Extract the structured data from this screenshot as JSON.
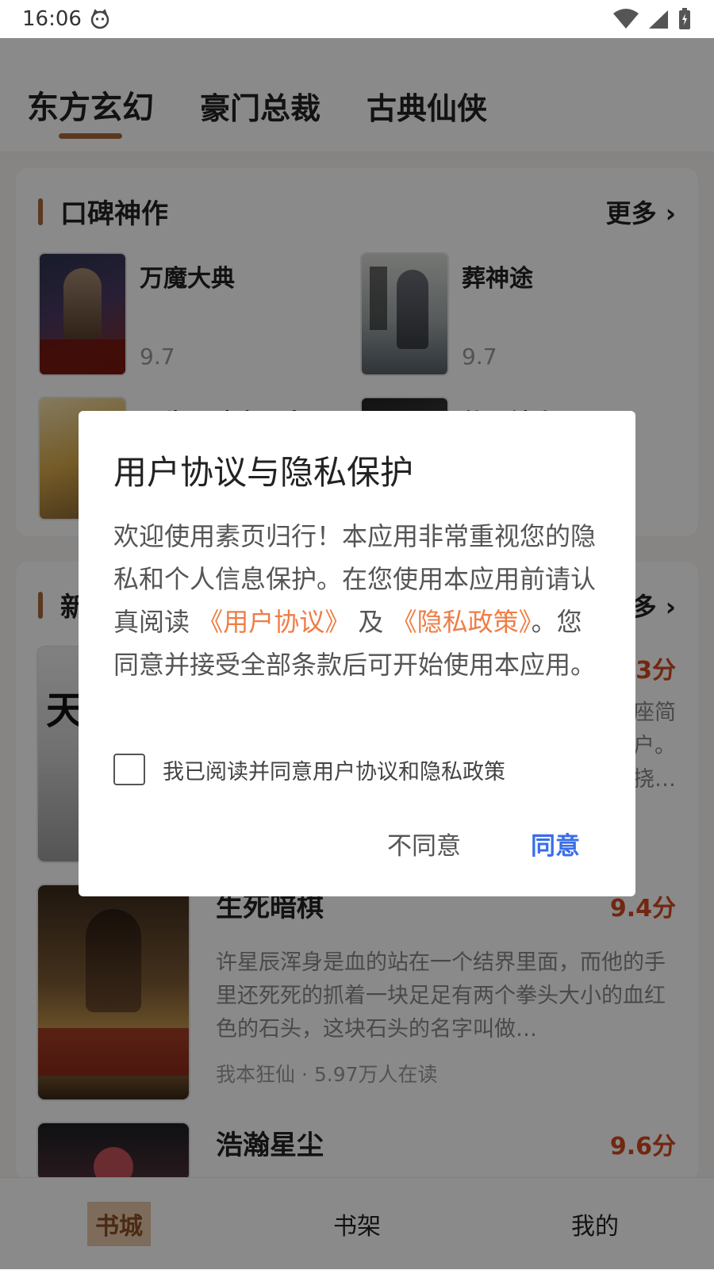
{
  "status_bar": {
    "time": "16:06"
  },
  "tabs": [
    {
      "label": "东方玄幻"
    },
    {
      "label": "豪门总裁"
    },
    {
      "label": "古典仙侠"
    }
  ],
  "section1": {
    "title": "口碑神作",
    "more": "更多 ›",
    "books": [
      {
        "name": "万魔大典",
        "score": "9.7"
      },
      {
        "name": "葬神途",
        "score": "9.7"
      },
      {
        "name": "三生石破魔厄出",
        "score": ""
      },
      {
        "name": "仙王神尘",
        "score": ""
      }
    ]
  },
  "section2": {
    "title": "新",
    "more": "多 ›",
    "books": [
      {
        "name": "天",
        "score": "3分",
        "desc": "座简\n户。\n挠…",
        "meta": ""
      },
      {
        "name": "生死暗棋",
        "score": "9.4分",
        "desc": "许星辰浑身是血的站在一个结界里面，而他的手里还死死的抓着一块足足有两个拳头大小的血红色的石头，这块石头的名字叫做…",
        "meta": "我本狂仙 · 5.97万人在读"
      },
      {
        "name": "浩瀚星尘",
        "score": "9.6分",
        "desc": "",
        "meta": ""
      }
    ]
  },
  "bottom_nav": [
    {
      "label": "书城"
    },
    {
      "label": "书架"
    },
    {
      "label": "我的"
    }
  ],
  "dialog": {
    "title": "用户协议与隐私保护",
    "body_part1": "欢迎使用素页归行！本应用非常重视您的隐私和个人信息保护。在您使用本应用前请认真阅读 ",
    "link_terms": "《用户协议》",
    "body_and": " 及 ",
    "link_privacy": "《隐私政策》",
    "body_part2": "。您同意并接受全部条款后可开始使用本应用。",
    "checkbox_label": "我已阅读并同意用户协议和隐私政策",
    "disagree_label": "不同意",
    "agree_label": "同意"
  }
}
